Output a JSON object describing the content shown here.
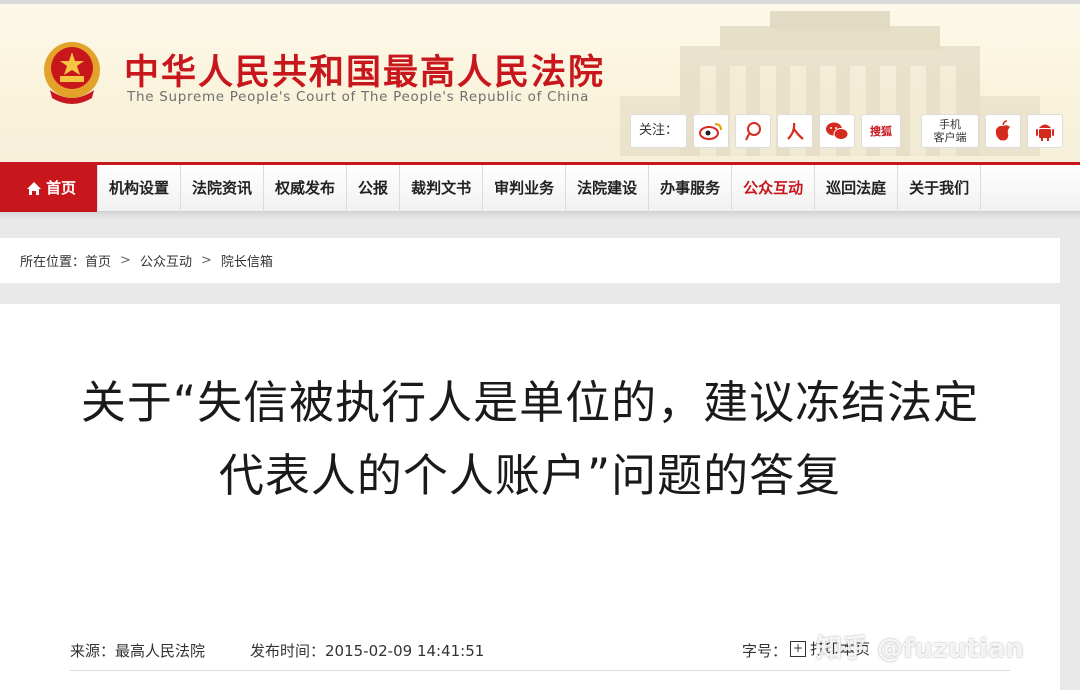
{
  "header": {
    "title": "中华人民共和国最高人民法院",
    "subtitle": "The Supreme People's Court of The People's Republic of China",
    "follow_label": "关注：",
    "sohu_label": "搜狐",
    "mobile_client": [
      "手机",
      "客户端"
    ],
    "social_icons": [
      "weibo-icon",
      "tencent-weibo-icon",
      "people-icon",
      "wechat-icon",
      "sohu-icon",
      "apple-icon",
      "android-icon"
    ]
  },
  "nav": {
    "items": [
      "首页",
      "机构设置",
      "法院资讯",
      "权威发布",
      "公报",
      "裁判文书",
      "审判业务",
      "法院建设",
      "办事服务",
      "公众互动",
      "巡回法庭",
      "关于我们"
    ],
    "active_index": 9
  },
  "breadcrumb": {
    "prefix": "所在位置：",
    "items": [
      "首页",
      "公众互动",
      "院长信箱"
    ],
    "separator": ">"
  },
  "article": {
    "title": "关于“失信被执行人是单位的，建议冻结法定代表人的个人账户”问题的答复",
    "source": "来源：最高人民法院",
    "publish_time": "发布时间：2015-02-09 14:41:51",
    "font_size_label": "字号：",
    "print_label": "打印本页"
  },
  "watermark": "知乎 @fuzutian",
  "colors": {
    "brand_red": "#c8161d"
  }
}
